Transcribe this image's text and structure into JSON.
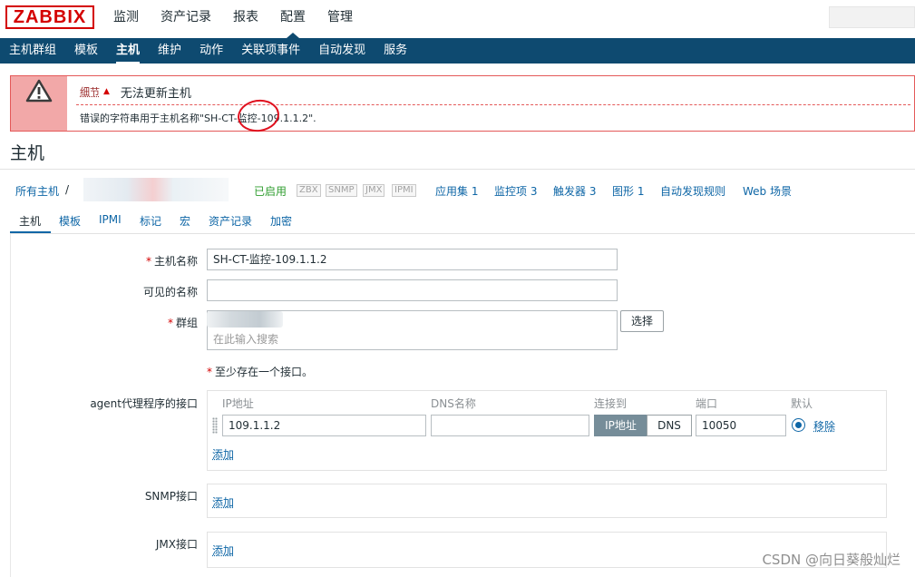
{
  "app": {
    "logo": "ZABBIX"
  },
  "main_menu": [
    {
      "label": "监测"
    },
    {
      "label": "资产记录"
    },
    {
      "label": "报表"
    },
    {
      "label": "配置",
      "active": true
    },
    {
      "label": "管理"
    }
  ],
  "sub_menu": [
    {
      "label": "主机群组"
    },
    {
      "label": "模板"
    },
    {
      "label": "主机",
      "active": true
    },
    {
      "label": "维护"
    },
    {
      "label": "动作"
    },
    {
      "label": "关联项事件"
    },
    {
      "label": "自动发现"
    },
    {
      "label": "服务"
    }
  ],
  "message": {
    "details_label": "细节",
    "title": "无法更新主机",
    "detail": "错误的字符串用于主机名称\"SH-CT-监控-109.1.1.2\"."
  },
  "page_title": "主机",
  "host_nav": {
    "all_hosts": "所有主机",
    "separator": "/",
    "status": "已启用",
    "badges": [
      "ZBX",
      "SNMP",
      "JMX",
      "IPMI"
    ],
    "links": [
      "应用集 1",
      "监控项 3",
      "触发器 3",
      "图形 1",
      "自动发现规则",
      "Web 场景"
    ]
  },
  "tabs": [
    "主机",
    "模板",
    "IPMI",
    "标记",
    "宏",
    "资产记录",
    "加密"
  ],
  "form": {
    "host_name_label": "主机名称",
    "host_name_value": "SH-CT-监控-109.1.1.2",
    "visible_name_label": "可见的名称",
    "visible_name_value": "",
    "groups_label": "群组",
    "groups_placeholder": "在此输入搜索",
    "select_button": "选择",
    "interface_note": "至少存在一个接口。",
    "agent_label": "agent代理程序的接口",
    "columns": {
      "ip": "IP地址",
      "dns": "DNS名称",
      "connect": "连接到",
      "port": "端口",
      "default": "默认"
    },
    "agent_interface": {
      "ip": "109.1.1.2",
      "dns": "",
      "connect_ip": "IP地址",
      "connect_dns": "DNS",
      "port": "10050",
      "remove": "移除"
    },
    "add_label": "添加",
    "snmp_label": "SNMP接口",
    "jmx_label": "JMX接口"
  },
  "watermark": "CSDN @向日葵般灿烂",
  "colors": {
    "nav_bg": "#0e4a70",
    "error_border": "#e45959",
    "error_icon_bg": "#f2a8a8",
    "link": "#0e66a6",
    "enabled": "#2f9d2f",
    "brand": "#d40000"
  }
}
